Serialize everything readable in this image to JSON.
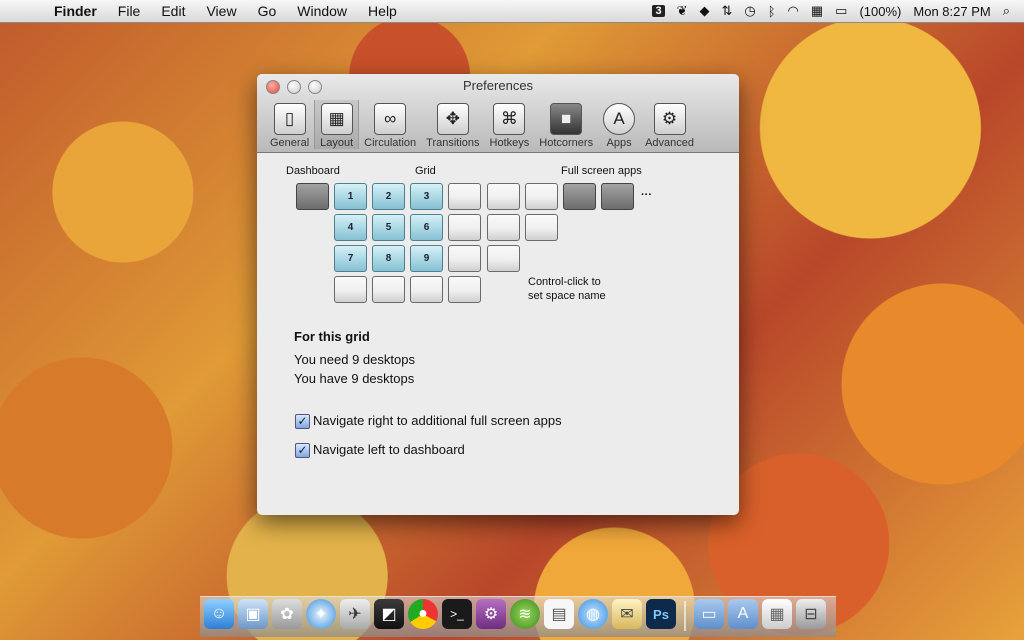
{
  "menubar": {
    "items": [
      "Finder",
      "File",
      "Edit",
      "View",
      "Go",
      "Window",
      "Help"
    ],
    "space_number": "3",
    "battery": "(100%)",
    "clock": "Mon 8:27 PM"
  },
  "window": {
    "title": "Preferences",
    "toolbar": [
      {
        "label": "General",
        "icon": "switch-icon"
      },
      {
        "label": "Layout",
        "icon": "grid-icon"
      },
      {
        "label": "Circulation",
        "icon": "loop-icon"
      },
      {
        "label": "Transitions",
        "icon": "move-arrows-icon"
      },
      {
        "label": "Hotkeys",
        "icon": "command-key-icon"
      },
      {
        "label": "Hotcorners",
        "icon": "screen-icon"
      },
      {
        "label": "Apps",
        "icon": "app-store-icon"
      },
      {
        "label": "Advanced",
        "icon": "gear-icon"
      }
    ],
    "active_tab": "Layout",
    "layout": {
      "dashboard_label": "Dashboard",
      "grid_label": "Grid",
      "fullscreen_label": "Full screen apps",
      "ellipsis": "···",
      "tiles": [
        "1",
        "2",
        "3",
        "4",
        "5",
        "6",
        "7",
        "8",
        "9"
      ],
      "hint_line1": "Control-click to",
      "hint_line2": "set space name"
    },
    "summary": {
      "heading": "For this grid",
      "need": "You need 9 desktops",
      "have": "You have 9 desktops"
    },
    "options": [
      {
        "label": "Navigate right to additional full screen apps",
        "checked": true
      },
      {
        "label": "Navigate left to dashboard",
        "checked": true
      }
    ]
  },
  "dock": {
    "apps": [
      "finder-icon",
      "preview-icon",
      "photos-icon",
      "safari-icon",
      "xcode-icon",
      "screenshot-icon",
      "chrome-icon",
      "terminal-icon",
      "system-prefs-icon",
      "spotify-icon",
      "textedit-icon",
      "messages-icon",
      "mail-icon",
      "photoshop-icon",
      "folder-icon",
      "applications-icon",
      "documents-icon",
      "trash-icon"
    ]
  }
}
